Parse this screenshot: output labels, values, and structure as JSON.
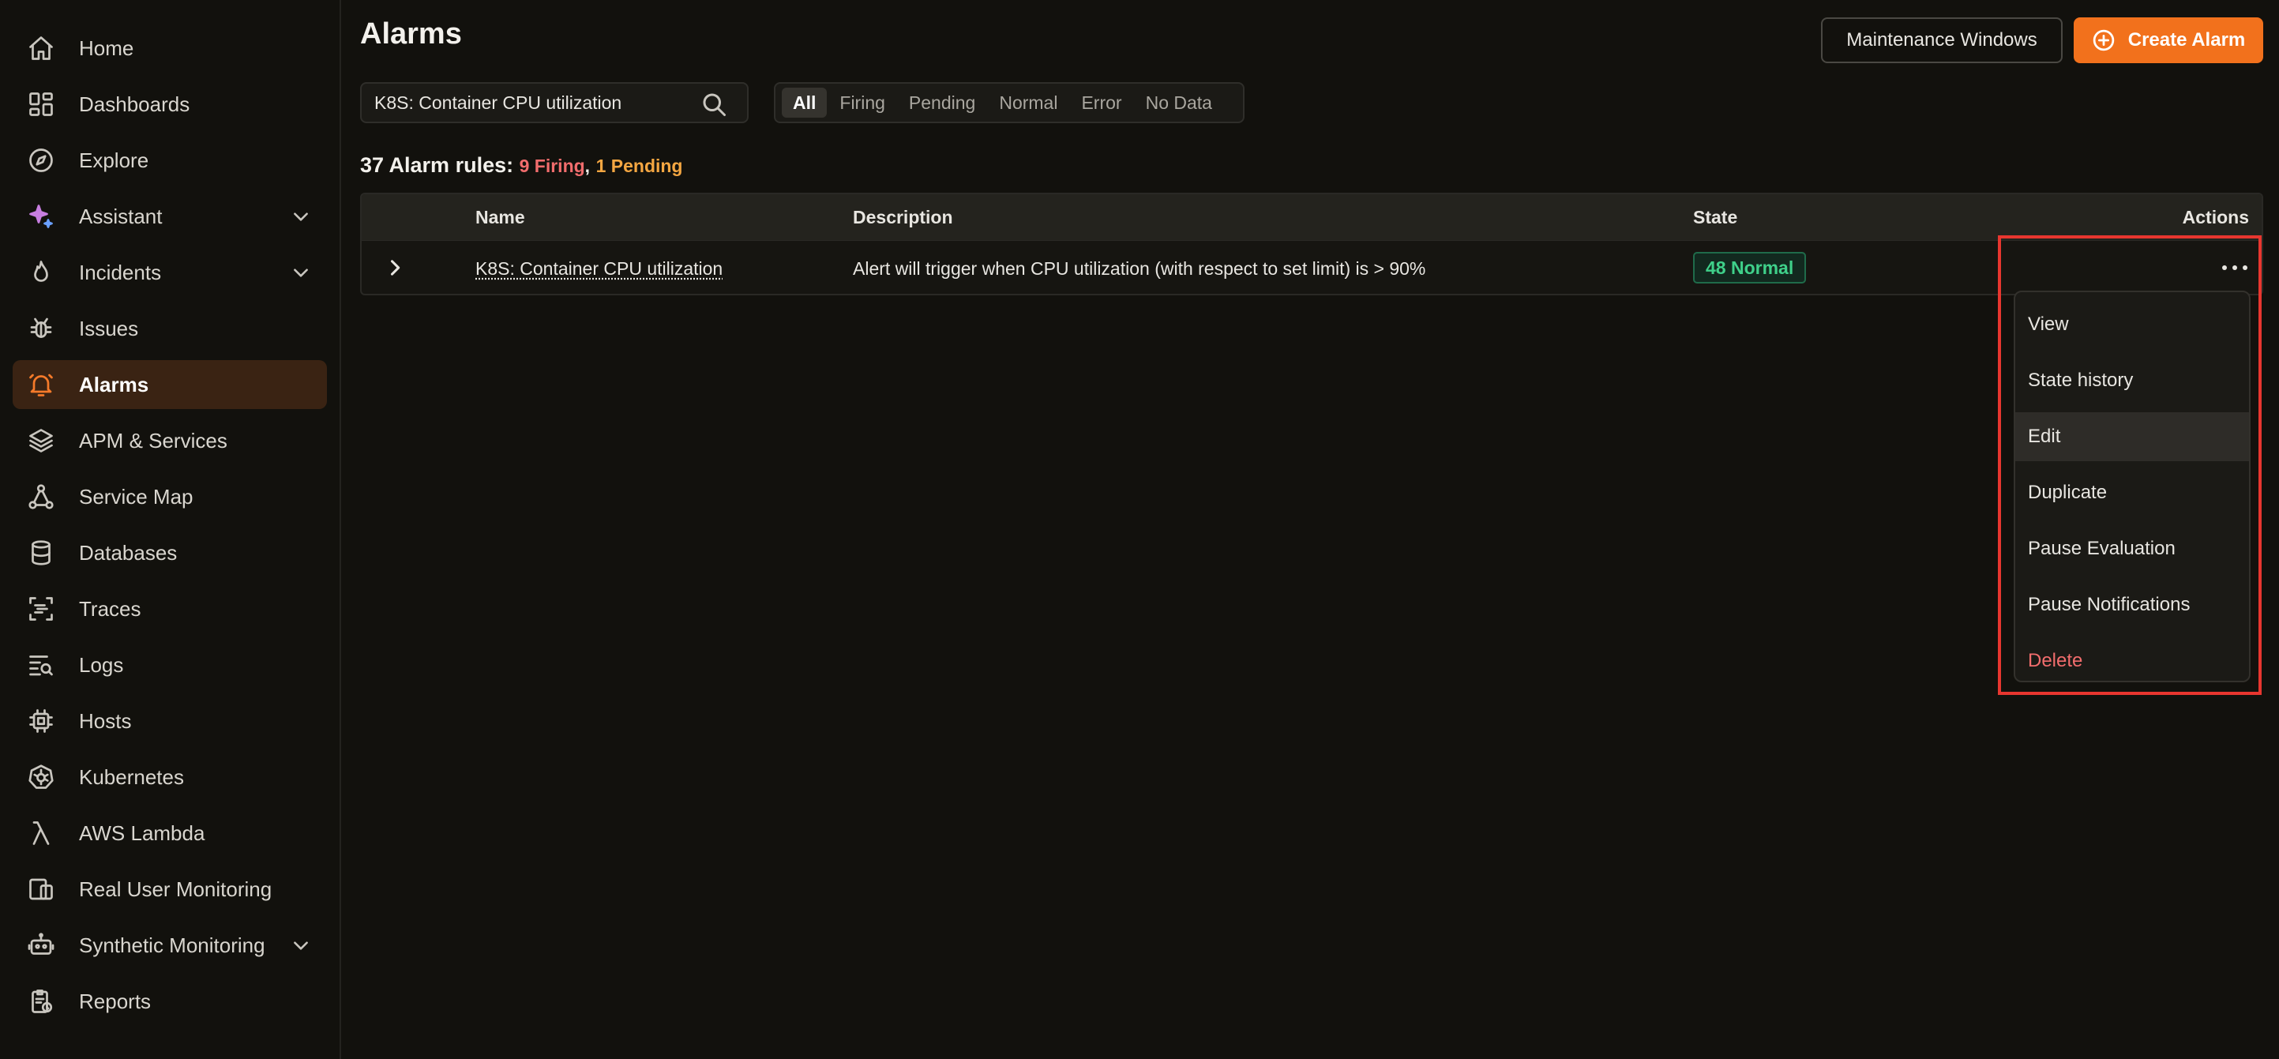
{
  "sidebar": {
    "items": [
      {
        "label": "Home",
        "icon": "home-icon"
      },
      {
        "label": "Dashboards",
        "icon": "dashboards-icon"
      },
      {
        "label": "Explore",
        "icon": "compass-icon"
      },
      {
        "label": "Assistant",
        "icon": "sparkle-icon"
      },
      {
        "label": "Incidents",
        "icon": "flame-icon"
      },
      {
        "label": "Issues",
        "icon": "bug-icon"
      },
      {
        "label": "Alarms",
        "icon": "bell-icon"
      },
      {
        "label": "APM & Services",
        "icon": "layers-icon"
      },
      {
        "label": "Service Map",
        "icon": "network-icon"
      },
      {
        "label": "Databases",
        "icon": "database-icon"
      },
      {
        "label": "Traces",
        "icon": "traces-icon"
      },
      {
        "label": "Logs",
        "icon": "logs-icon"
      },
      {
        "label": "Hosts",
        "icon": "chip-icon"
      },
      {
        "label": "Kubernetes",
        "icon": "kubernetes-icon"
      },
      {
        "label": "AWS Lambda",
        "icon": "lambda-icon"
      },
      {
        "label": "Real User Monitoring",
        "icon": "devices-icon"
      },
      {
        "label": "Synthetic Monitoring",
        "icon": "robot-icon"
      },
      {
        "label": "Reports",
        "icon": "reports-icon"
      }
    ],
    "active": "Alarms",
    "accent_color": "#f57a2a"
  },
  "header": {
    "title": "Alarms",
    "maintenance_label": "Maintenance Windows",
    "create_label": "Create Alarm",
    "create_color": "#f2711c"
  },
  "search": {
    "value": "K8S: Container CPU utilization"
  },
  "filters": {
    "tabs": [
      "All",
      "Firing",
      "Pending",
      "Normal",
      "Error",
      "No Data"
    ],
    "active": "All"
  },
  "summary": {
    "prefix": "37 Alarm rules:",
    "firing": "9 Firing",
    "separator": ",",
    "pending": "1 Pending",
    "firing_color": "#f26d6d",
    "pending_color": "#f5a742"
  },
  "table": {
    "columns": [
      "Name",
      "Description",
      "State",
      "Actions"
    ],
    "rows": [
      {
        "name": "K8S: Container CPU utilization",
        "description": "Alert will trigger when CPU utilization (with respect to set limit) is > 90%",
        "state": "48 Normal"
      }
    ]
  },
  "actions_menu": {
    "items": [
      "View",
      "State history",
      "Edit",
      "Duplicate",
      "Pause Evaluation",
      "Pause Notifications",
      "Delete"
    ],
    "hovered": "Edit",
    "danger_item": "Delete",
    "highlight_color": "#e8362f"
  }
}
